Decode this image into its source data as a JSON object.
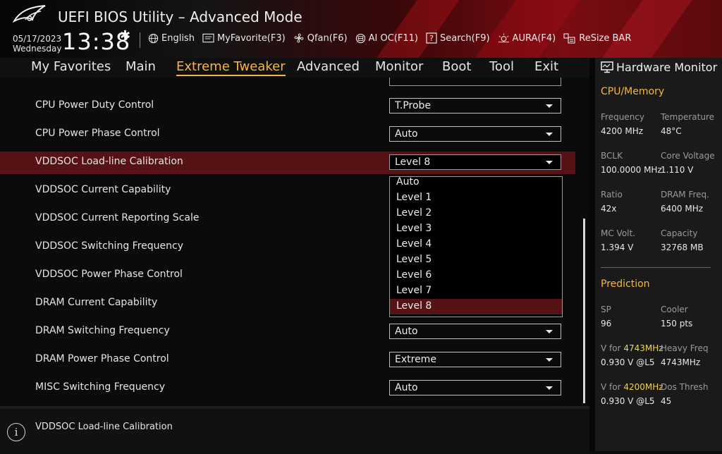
{
  "header": {
    "title": "UEFI BIOS Utility – Advanced Mode",
    "date": "05/17/2023",
    "day": "Wednesday",
    "time": "13:38",
    "tools": [
      {
        "label": "English",
        "icon": "globe-icon"
      },
      {
        "label": "MyFavorite(F3)",
        "icon": "favorite-icon"
      },
      {
        "label": "Qfan(F6)",
        "icon": "fan-icon"
      },
      {
        "label": "AI OC(F11)",
        "icon": "ai-oc-icon"
      },
      {
        "label": "Search(F9)",
        "icon": "search-icon"
      },
      {
        "label": "AURA(F4)",
        "icon": "aura-icon"
      },
      {
        "label": "ReSize BAR",
        "icon": "resize-bar-icon"
      }
    ]
  },
  "nav": {
    "tabs": [
      "My Favorites",
      "Main",
      "Extreme Tweaker",
      "Advanced",
      "Monitor",
      "Boot",
      "Tool",
      "Exit"
    ],
    "active": "Extreme Tweaker"
  },
  "settings": [
    {
      "label": "CPU Power Duty Control",
      "value": "T.Probe"
    },
    {
      "label": "CPU Power Phase Control",
      "value": "Auto"
    },
    {
      "label": "VDDSOC Load-line Calibration",
      "value": "Level 8"
    },
    {
      "label": "VDDSOC Current Capability",
      "value": ""
    },
    {
      "label": "VDDSOC Current Reporting Scale",
      "value": ""
    },
    {
      "label": "VDDSOC Switching Frequency",
      "value": ""
    },
    {
      "label": "VDDSOC Power Phase Control",
      "value": ""
    },
    {
      "label": "DRAM Current Capability",
      "value": ""
    },
    {
      "label": "DRAM Switching Frequency",
      "value": "Auto"
    },
    {
      "label": "DRAM Power Phase Control",
      "value": "Extreme"
    },
    {
      "label": "MISC Switching Frequency",
      "value": "Auto"
    }
  ],
  "dropdown": {
    "options": [
      "Auto",
      "Level 1",
      "Level 2",
      "Level 3",
      "Level 4",
      "Level 5",
      "Level 6",
      "Level 7",
      "Level 8"
    ],
    "selected": "Level 8"
  },
  "help": {
    "text": "VDDSOC Load-line Calibration"
  },
  "hardware_monitor": {
    "title": "Hardware Monitor",
    "cpu_memory": {
      "heading": "CPU/Memory",
      "frequency_label": "Frequency",
      "frequency": "4200 MHz",
      "temperature_label": "Temperature",
      "temperature": "48°C",
      "bclk_label": "BCLK",
      "bclk": "100.0000 MHz",
      "core_voltage_label": "Core Voltage",
      "core_voltage": "1.110 V",
      "ratio_label": "Ratio",
      "ratio": "42x",
      "dram_freq_label": "DRAM Freq.",
      "dram_freq": "6400 MHz",
      "mc_volt_label": "MC Volt.",
      "mc_volt": "1.394 V",
      "capacity_label": "Capacity",
      "capacity": "32768 MB"
    },
    "prediction": {
      "heading": "Prediction",
      "sp_label": "SP",
      "sp": "96",
      "cooler_label": "Cooler",
      "cooler": "150 pts",
      "v_for_prefix": "V for ",
      "v_for_1_freq": "4743MHz",
      "v_for_1_value": "0.930 V @L5",
      "heavy_freq_label": "Heavy Freq",
      "heavy_freq": "4743MHz",
      "v_for_2_freq": "4200MHz",
      "v_for_2_value": "0.930 V @L5",
      "dos_thresh_label": "Dos Thresh",
      "dos_thresh": "45"
    }
  },
  "colors": {
    "accent": "#f6b73c",
    "selected_row": "#561214",
    "highlight_value": "#f3d64a"
  }
}
